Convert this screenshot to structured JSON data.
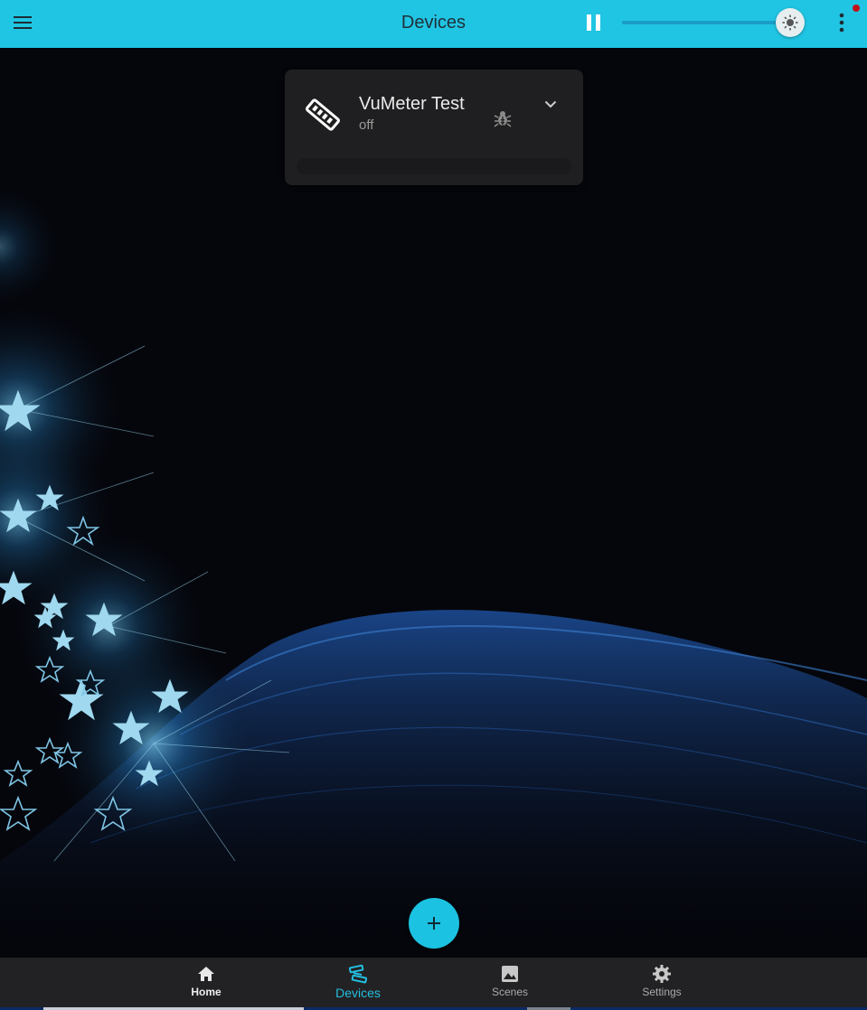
{
  "appbar": {
    "title": "Devices",
    "brightness": 0.98,
    "accent_color": "#20c5e3",
    "icons": {
      "menu": "menu-icon",
      "pause": "pause-icon",
      "brightness": "sun-icon",
      "more": "more-vert-icon"
    },
    "notification_dot_color": "#c0101a"
  },
  "device": {
    "name": "VuMeter Test",
    "status": "off",
    "icons": {
      "device": "led-strip-icon",
      "debug": "bug-icon",
      "expand": "chevron-down-icon"
    }
  },
  "fab": {
    "icon": "plus-icon"
  },
  "nav": {
    "items": [
      {
        "label": "Home",
        "icon": "home-icon"
      },
      {
        "label": "Devices",
        "icon": "devices-icon",
        "active": true
      },
      {
        "label": "Scenes",
        "icon": "image-icon"
      },
      {
        "label": "Settings",
        "icon": "gear-icon"
      }
    ],
    "active_color": "#22bfe0"
  }
}
